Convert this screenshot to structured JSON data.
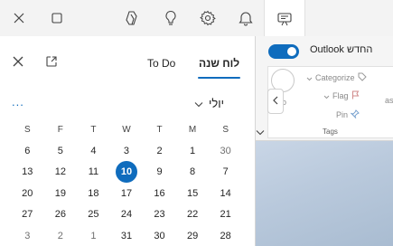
{
  "titlebar": {
    "buttons": [
      "close-icon",
      "square-icon",
      "copilot-icon",
      "lightbulb-icon",
      "gear-icon",
      "bell-icon",
      "my-day-icon"
    ]
  },
  "pane": {
    "tabs": {
      "calendar": "לוח שנה",
      "todo": "To Do"
    },
    "month": "יולי",
    "more": "...",
    "weekdays": [
      "S",
      "F",
      "T",
      "W",
      "T",
      "M",
      "S"
    ],
    "weeks": [
      [
        {
          "d": "6"
        },
        {
          "d": "5"
        },
        {
          "d": "4"
        },
        {
          "d": "3"
        },
        {
          "d": "2"
        },
        {
          "d": "1"
        },
        {
          "d": "30",
          "muted": true
        }
      ],
      [
        {
          "d": "13"
        },
        {
          "d": "12"
        },
        {
          "d": "11"
        },
        {
          "d": "10",
          "today": true
        },
        {
          "d": "9"
        },
        {
          "d": "8"
        },
        {
          "d": "7"
        }
      ],
      [
        {
          "d": "20"
        },
        {
          "d": "19"
        },
        {
          "d": "18"
        },
        {
          "d": "17"
        },
        {
          "d": "16"
        },
        {
          "d": "15"
        },
        {
          "d": "14"
        }
      ],
      [
        {
          "d": "27"
        },
        {
          "d": "26"
        },
        {
          "d": "25"
        },
        {
          "d": "24"
        },
        {
          "d": "23"
        },
        {
          "d": "22"
        },
        {
          "d": "21"
        }
      ],
      [
        {
          "d": "3",
          "muted": true
        },
        {
          "d": "2",
          "muted": true
        },
        {
          "d": "1",
          "muted": true
        },
        {
          "d": "31"
        },
        {
          "d": "30"
        },
        {
          "d": "29"
        },
        {
          "d": "28"
        }
      ]
    ]
  },
  "background": {
    "toggle_label": "Outlook החדש",
    "toggle_on": true,
    "categorize": "Categorize",
    "flag": "Flag",
    "pin": "Pin",
    "snooze": "Sno",
    "as_fragment": "as",
    "tags_label": "Tags"
  },
  "colors": {
    "accent": "#0f6cbd",
    "titlebar_bg": "#f3f3f3"
  }
}
